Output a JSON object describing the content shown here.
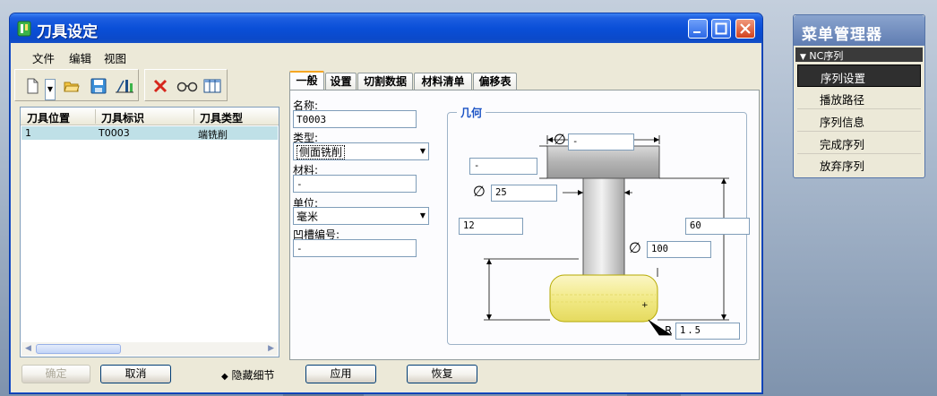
{
  "window": {
    "title": "刀具设定"
  },
  "menubar": {
    "items": [
      "文件",
      "编辑",
      "视图"
    ]
  },
  "toolbar": {
    "icons": [
      "new-icon",
      "dropdown-icon",
      "open-folder-icon",
      "save-icon",
      "tool-table-icon",
      "delete-icon",
      "view-icon",
      "table-columns-icon"
    ]
  },
  "tool_table": {
    "columns": [
      "刀具位置",
      "刀具标识",
      "刀具类型"
    ],
    "rows": [
      {
        "position": "1",
        "id": "T0003",
        "type": "端铣削"
      }
    ]
  },
  "left_buttons": {
    "ok_label": "确定",
    "cancel_label": "取消",
    "hide_details_label": "隐藏细节"
  },
  "tabs": [
    "一般",
    "设置",
    "切割数据",
    "材料清单",
    "偏移表"
  ],
  "form": {
    "name_label": "名称:",
    "name_value": "T0003",
    "type_label": "类型:",
    "type_value": "侧面铣削",
    "material_label": "材料:",
    "material_value": "-",
    "unit_label": "单位:",
    "unit_value": "毫米",
    "groove_label": "凹槽编号:",
    "groove_value": "-"
  },
  "geometry": {
    "legend": "几何",
    "top_diameter": "-",
    "top_height": "-",
    "shank_diameter": "25",
    "length_left": "12",
    "length_right": "60",
    "cutter_diameter": "100",
    "radius_label": "R",
    "radius_value": "1.5"
  },
  "bottom_buttons": {
    "apply_label": "应用",
    "restore_label": "恢复"
  },
  "menu_manager": {
    "title": "菜单管理器",
    "section": "NC序列",
    "items": [
      "序列设置",
      "播放路径",
      "序列信息",
      "完成序列",
      "放弃序列"
    ]
  },
  "colors": {
    "title_bar": "#0b4fd8",
    "selected_row": "#bfe0e7",
    "cutter_fill": "#f5f0a0",
    "menu_active": "#2f2f2f"
  }
}
